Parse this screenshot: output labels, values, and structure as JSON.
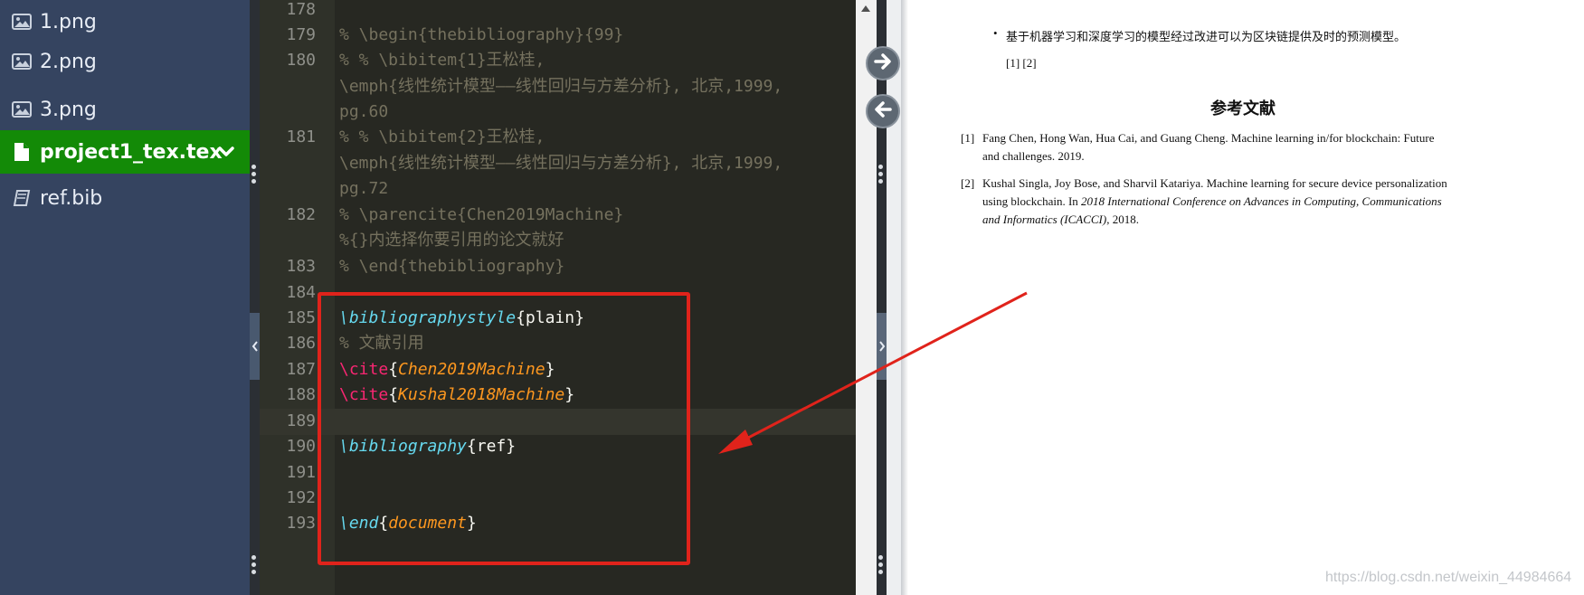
{
  "sidebar": {
    "files": [
      {
        "name": "1.png",
        "icon": "image-icon"
      },
      {
        "name": "2.png",
        "icon": "image-icon"
      },
      {
        "name": "3.png",
        "icon": "image-icon"
      },
      {
        "name": "project1_tex.tex",
        "icon": "file-icon",
        "active": true
      },
      {
        "name": "ref.bib",
        "icon": "book-icon"
      }
    ]
  },
  "editor": {
    "line_numbers": [
      "178",
      "179",
      "180",
      "181",
      "182",
      "183",
      "184",
      "185",
      "186",
      "187",
      "188",
      "189",
      "190",
      "191",
      "192",
      "193"
    ],
    "lines": {
      "l179": "% \\begin{thebibliography}{99}",
      "l180a": "% % \\bibitem{1}王松桂,",
      "l180b": "\\emph{线性统计模型——线性回归与方差分析}, 北京,1999,",
      "l180c": "pg.60",
      "l181a": "% % \\bibitem{2}王松桂,",
      "l181b": "\\emph{线性统计模型——线性回归与方差分析}, 北京,1999,",
      "l181c": "pg.72",
      "l182a": "% \\parencite{Chen2019Machine}",
      "l182b": "%{}内选择你要引用的论文就好",
      "l183": "% \\end{thebibliography}",
      "l185_cmd": "\\bibliographystyle",
      "l185_open": "{",
      "l185_arg": "plain",
      "l185_close": "}",
      "l186": "% 文献引用",
      "l187_cmd": "\\cite",
      "l187_open": "{",
      "l187_arg": "Chen2019Machine",
      "l187_close": "}",
      "l188_cmd": "\\cite",
      "l188_open": "{",
      "l188_arg": "Kushal2018Machine",
      "l188_close": "}",
      "l190_cmd": "\\bibliography",
      "l190_open": "{",
      "l190_arg": "ref",
      "l190_close": "}",
      "l193_cmd": "\\end",
      "l193_open": "{",
      "l193_arg": "document",
      "l193_close": "}"
    }
  },
  "preview": {
    "bullet_text": "基于机器学习和深度学习的模型经过改进可以为区块链提供及时的预测模型。",
    "citations": "[1] [2]",
    "heading": "参考文献",
    "references": [
      {
        "num": "[1]",
        "text_a": "Fang Chen, Hong Wan, Hua Cai, and Guang Cheng. Machine learning in/for blockchain: Future",
        "text_b": "and challenges. 2019."
      },
      {
        "num": "[2]",
        "text_a": "Kushal Singla, Joy Bose, and Sharvil Katariya. Machine learning for secure device personalization",
        "text_b_plain": "using blockchain. In ",
        "text_b_italic": "2018 International Conference on Advances in Computing, Communications",
        "text_c_italic": "and Informatics (ICACCI)",
        "text_c_plain": ", 2018."
      }
    ],
    "watermark": "https://blog.csdn.net/weixin_44984664"
  },
  "colors": {
    "sidebar_bg": "#354460",
    "active_file_bg": "#138a07",
    "editor_bg": "#272822",
    "annotation_red": "#e0231b"
  }
}
